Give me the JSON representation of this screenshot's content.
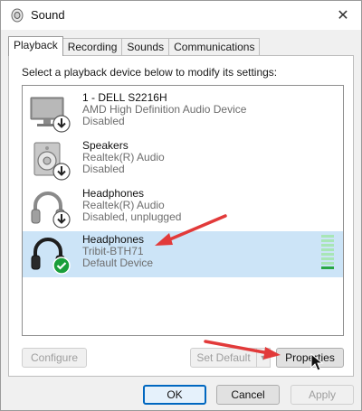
{
  "window": {
    "title": "Sound",
    "close_glyph": "✕"
  },
  "tabs": [
    {
      "label": "Playback",
      "active": true
    },
    {
      "label": "Recording",
      "active": false
    },
    {
      "label": "Sounds",
      "active": false
    },
    {
      "label": "Communications",
      "active": false
    }
  ],
  "playback": {
    "instruction": "Select a playback device below to modify its settings:",
    "devices": [
      {
        "name": "1 - DELL S2216H",
        "driver": "AMD High Definition Audio Device",
        "status": "Disabled",
        "icon": "monitor-icon",
        "badge": "disabled-arrow",
        "selected": false
      },
      {
        "name": "Speakers",
        "driver": "Realtek(R) Audio",
        "status": "Disabled",
        "icon": "speaker-icon",
        "badge": "disabled-arrow",
        "selected": false
      },
      {
        "name": "Headphones",
        "driver": "Realtek(R) Audio",
        "status": "Disabled, unplugged",
        "icon": "headphones-icon",
        "badge": "disabled-arrow",
        "selected": false
      },
      {
        "name": "Headphones",
        "driver": "Tribit-BTH71",
        "status": "Default Device",
        "icon": "headphones-icon",
        "badge": "default-check",
        "selected": true
      }
    ],
    "buttons": {
      "configure": "Configure",
      "set_default": "Set Default",
      "properties": "Properties"
    }
  },
  "footer": {
    "ok": "OK",
    "cancel": "Cancel",
    "apply": "Apply"
  },
  "colors": {
    "selection": "#cce4f7",
    "accent": "#0067c0",
    "annotation_arrow": "#e23a3a",
    "default_check": "#1a9e3a"
  }
}
